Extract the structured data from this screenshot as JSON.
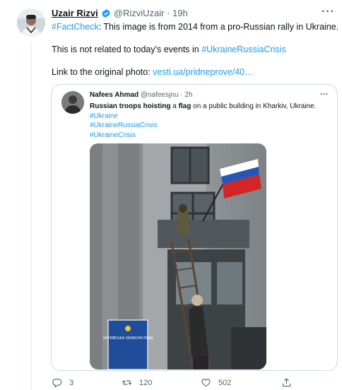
{
  "tweet": {
    "author_name": "Uzair Rizvi",
    "author_handle": "@RizviUzair",
    "time": "19h",
    "line1_hashtag": "#FactCheck",
    "line1_text": ": This image is from 2014 from a pro-Russian rally in Ukraine.",
    "line2_text": "This is not related to today's events in ",
    "line2_hashtag": "#UkraineRussiaCrisis",
    "line3_text": "Link to the original photo: ",
    "line3_link": "vesti.ua/pridneprove/40…"
  },
  "quote": {
    "author_name": "Nafees Ahmad",
    "author_handle": "@nafeesjnu",
    "time": "2h",
    "text_bold1": "Russian troops hoisting",
    "text_mid": " a ",
    "text_bold2": "flag",
    "text_rest": " on a public building in Kharkiv, Ukraine.",
    "hashtags": [
      "#Ukraine",
      "#UkraineRussiaCrisis",
      "#UkraineCrisis"
    ],
    "sign_text": "ХАРКІВСЬКА ОБЛАСНА РАДА"
  },
  "actions": {
    "replies": "3",
    "retweets": "120",
    "likes": "502"
  },
  "icons": [
    "verified-icon",
    "more-icon",
    "reply-icon",
    "retweet-icon",
    "like-icon",
    "share-icon"
  ],
  "colors": {
    "link": "#1d9bf0",
    "muted": "#536471",
    "text": "#0f1419",
    "border": "#cfd9de"
  }
}
